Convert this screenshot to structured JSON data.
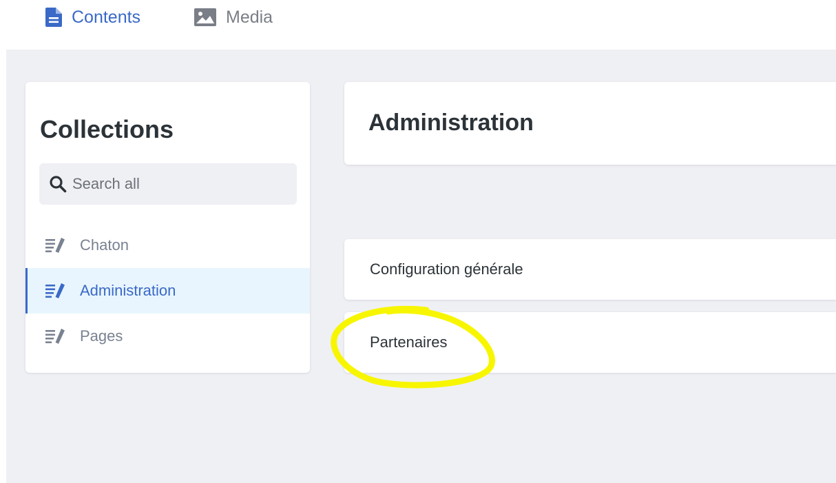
{
  "nav": {
    "contents_label": "Contents",
    "media_label": "Media",
    "contents_icon": "document-icon",
    "media_icon": "image-icon"
  },
  "sidebar": {
    "title": "Collections",
    "search_placeholder": "Search all",
    "items": [
      {
        "label": "Chaton",
        "icon": "collection-edit-icon",
        "active": false
      },
      {
        "label": "Administration",
        "icon": "collection-edit-icon",
        "active": true
      },
      {
        "label": "Pages",
        "icon": "collection-edit-icon",
        "active": false
      }
    ]
  },
  "main": {
    "title": "Administration",
    "entries": [
      {
        "label": "Configuration générale"
      },
      {
        "label": "Partenaires",
        "highlighted": true
      }
    ]
  },
  "colors": {
    "accent": "#3a69c7",
    "background": "#eff0f4",
    "active_item_bg": "#e8f5fe",
    "highlight_marker": "#f7f600"
  }
}
